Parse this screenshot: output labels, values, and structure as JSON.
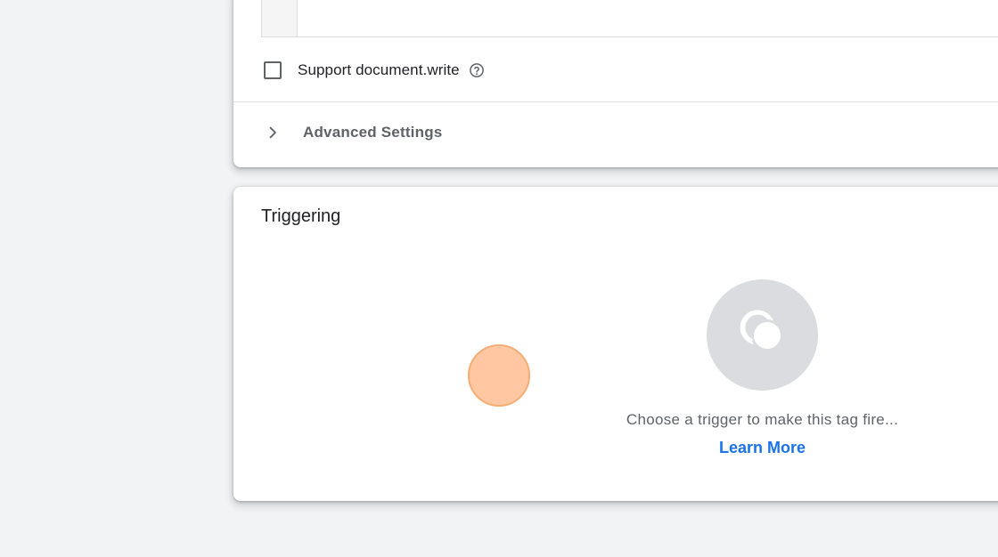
{
  "tag_config": {
    "support_document_write": {
      "label": "Support document.write",
      "checked": false,
      "help_icon": "help-circle-icon"
    },
    "advanced_settings": {
      "label": "Advanced Settings",
      "expand_icon": "chevron-right-icon"
    }
  },
  "triggering": {
    "title": "Triggering",
    "empty_icon": "trigger-icon",
    "empty_message": "Choose a trigger to make this tag fire...",
    "learn_more_label": "Learn More"
  },
  "colors": {
    "page_background": "#f1f3f4",
    "card_background": "#ffffff",
    "link": "#1a73e8",
    "icon_circle": "#dadce0",
    "click_marker": "#ffc299"
  }
}
